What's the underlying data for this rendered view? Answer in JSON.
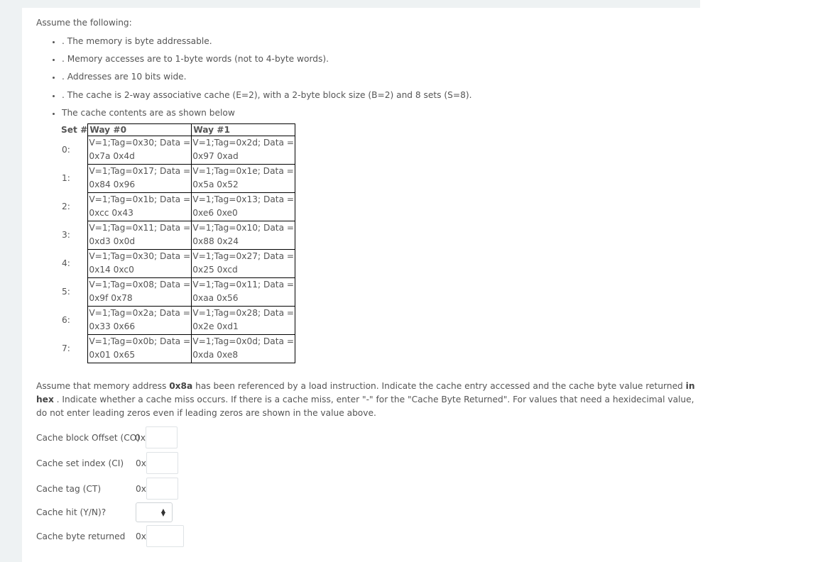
{
  "intro": "Assume the following:",
  "assumptions": [
    ". The memory is byte addressable.",
    ". Memory accesses are to 1-byte words (not to 4-byte words).",
    ". Addresses are 10 bits wide.",
    ". The cache is 2-way associative cache (E=2), with a 2-byte block size (B=2) and 8 sets (S=8).",
    "The cache contents are as shown below"
  ],
  "table": {
    "headers": [
      "Set #",
      "Way #0",
      "Way #1"
    ],
    "rows": [
      {
        "set": "0:",
        "way0": [
          "V=1;Tag=0x30; Data =",
          "0x7a 0x4d"
        ],
        "way1": [
          "V=1;Tag=0x2d; Data =",
          "0x97 0xad"
        ]
      },
      {
        "set": "1:",
        "way0": [
          "V=1;Tag=0x17; Data =",
          "0x84 0x96"
        ],
        "way1": [
          "V=1;Tag=0x1e; Data =",
          "0x5a 0x52"
        ]
      },
      {
        "set": "2:",
        "way0": [
          "V=1;Tag=0x1b; Data =",
          "0xcc 0x43"
        ],
        "way1": [
          "V=1;Tag=0x13; Data =",
          "0xe6 0xe0"
        ]
      },
      {
        "set": "3:",
        "way0": [
          "V=1;Tag=0x11; Data =",
          "0xd3 0x0d"
        ],
        "way1": [
          "V=1;Tag=0x10; Data =",
          "0x88 0x24"
        ]
      },
      {
        "set": "4:",
        "way0": [
          "V=1;Tag=0x30; Data =",
          "0x14 0xc0"
        ],
        "way1": [
          "V=1;Tag=0x27; Data =",
          "0x25 0xcd"
        ]
      },
      {
        "set": "5:",
        "way0": [
          "V=1;Tag=0x08; Data =",
          "0x9f 0x78"
        ],
        "way1": [
          "V=1;Tag=0x11; Data =",
          "0xaa 0x56"
        ]
      },
      {
        "set": "6:",
        "way0": [
          "V=1;Tag=0x2a; Data =",
          "0x33 0x66"
        ],
        "way1": [
          "V=1;Tag=0x28; Data =",
          "0x2e 0xd1"
        ]
      },
      {
        "set": "7:",
        "way0": [
          "V=1;Tag=0x0b; Data =",
          "0x01 0x65"
        ],
        "way1": [
          "V=1;Tag=0x0d; Data =",
          "0xda 0xe8"
        ]
      }
    ]
  },
  "question": {
    "p1": "Assume that memory address ",
    "address": "0x8a",
    "p2": " has been referenced by a load instruction. Indicate the cache entry accessed and the cache byte value returned ",
    "emph": "in hex",
    "p3": " . Indicate whether a cache miss occurs. If there is a cache miss, enter \"-\" for the \"Cache Byte Returned\". For values that need a hexidecimal value, do not enter leading zeros even if leading zeros are shown in the value above."
  },
  "form": {
    "prefix": "0x",
    "fields": [
      {
        "label": "Cache block Offset (CO)",
        "value": ""
      },
      {
        "label": "Cache set index (CI)",
        "value": ""
      },
      {
        "label": "Cache tag (CT)",
        "value": ""
      }
    ],
    "hit": {
      "label": "Cache hit (Y/N)?",
      "selected": ""
    },
    "byte": {
      "label": "Cache byte returned",
      "value": ""
    }
  }
}
